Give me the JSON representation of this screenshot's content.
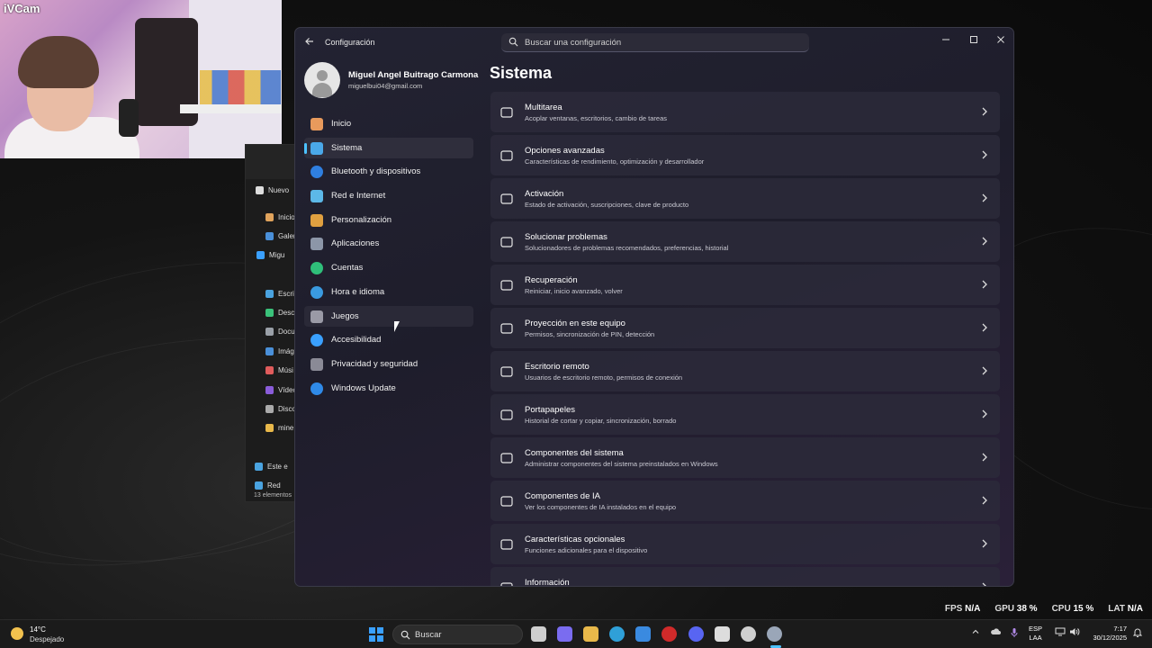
{
  "webcam": {
    "watermark": "iVCam"
  },
  "explorer": {
    "items": [
      {
        "label": "Nuevo",
        "icon": "plus-circle-icon",
        "color": "#dddddd"
      },
      {
        "label": "Inicio",
        "icon": "home-icon",
        "color": "#e0a35c"
      },
      {
        "label": "Galer",
        "icon": "gallery-icon",
        "color": "#4a90d9"
      },
      {
        "label": "Migu",
        "icon": "cloud-icon",
        "color": "#3aa0ff"
      },
      {
        "label": "Escrit",
        "icon": "desktop-icon",
        "color": "#4aa3e0"
      },
      {
        "label": "Desca",
        "icon": "download-icon",
        "color": "#3ac27a"
      },
      {
        "label": "Docu",
        "icon": "document-icon",
        "color": "#9aa0a8"
      },
      {
        "label": "Imág",
        "icon": "image-icon",
        "color": "#4a90d9"
      },
      {
        "label": "Músi",
        "icon": "music-icon",
        "color": "#e05c5c"
      },
      {
        "label": "Vídeo",
        "icon": "video-icon",
        "color": "#8a5cd9"
      },
      {
        "label": "Disco",
        "icon": "disk-icon",
        "color": "#aaaaaa"
      },
      {
        "label": "mine",
        "icon": "folder-icon",
        "color": "#e8b84a"
      },
      {
        "label": "Este e",
        "icon": "pc-icon",
        "color": "#4aa3e0"
      },
      {
        "label": "Red",
        "icon": "network-icon",
        "color": "#4aa3e0"
      }
    ],
    "status": "13 elementos"
  },
  "settings": {
    "app_title": "Configuración",
    "search_placeholder": "Buscar una configuración",
    "profile": {
      "name": "Miguel Angel Buitrago Carmona",
      "email": "miguelbui04@gmail.com"
    },
    "nav": [
      {
        "label": "Inicio",
        "icon": "home-icon",
        "color": "#e89a5c"
      },
      {
        "label": "Sistema",
        "icon": "monitor-icon",
        "color": "#4aa8e8"
      },
      {
        "label": "Bluetooth y dispositivos",
        "icon": "bluetooth-icon",
        "color": "#2f7fe0"
      },
      {
        "label": "Red e Internet",
        "icon": "wifi-icon",
        "color": "#5cb8e8"
      },
      {
        "label": "Personalización",
        "icon": "brush-icon",
        "color": "#e0a040"
      },
      {
        "label": "Aplicaciones",
        "icon": "apps-icon",
        "color": "#8c96a8"
      },
      {
        "label": "Cuentas",
        "icon": "person-icon",
        "color": "#2fbf7a"
      },
      {
        "label": "Hora e idioma",
        "icon": "globe-clock-icon",
        "color": "#3a9ae0"
      },
      {
        "label": "Juegos",
        "icon": "gamepad-icon",
        "color": "#9a9aa6"
      },
      {
        "label": "Accesibilidad",
        "icon": "accessibility-icon",
        "color": "#3aa0ff"
      },
      {
        "label": "Privacidad y seguridad",
        "icon": "shield-icon",
        "color": "#8a8a96"
      },
      {
        "label": "Windows Update",
        "icon": "update-icon",
        "color": "#2f8ae8"
      }
    ],
    "active_nav": "Sistema",
    "page_title": "Sistema",
    "cards": [
      {
        "title": "Multitarea",
        "desc": "Acoplar ventanas, escritorios, cambio de tareas",
        "icon": "multitask-icon"
      },
      {
        "title": "Opciones avanzadas",
        "desc": "Características de rendimiento, optimización y desarrollador",
        "icon": "sliders-icon"
      },
      {
        "title": "Activación",
        "desc": "Estado de activación, suscripciones, clave de producto",
        "icon": "check-circle-icon"
      },
      {
        "title": "Solucionar problemas",
        "desc": "Solucionadores de problemas recomendados, preferencias, historial",
        "icon": "wrench-icon"
      },
      {
        "title": "Recuperación",
        "desc": "Reiniciar, inicio avanzado, volver",
        "icon": "recovery-icon"
      },
      {
        "title": "Proyección en este equipo",
        "desc": "Permisos, sincronización de PIN, detección",
        "icon": "projection-icon"
      },
      {
        "title": "Escritorio remoto",
        "desc": "Usuarios de escritorio remoto, permisos de conexión",
        "icon": "remote-desktop-icon"
      },
      {
        "title": "Portapapeles",
        "desc": "Historial de cortar y copiar, sincronización, borrado",
        "icon": "clipboard-icon"
      },
      {
        "title": "Componentes del sistema",
        "desc": "Administrar componentes del sistema preinstalados en Windows",
        "icon": "components-icon"
      },
      {
        "title": "Componentes de IA",
        "desc": "Ver los componentes de IA instalados en el equipo",
        "icon": "sparkle-icon"
      },
      {
        "title": "Características opcionales",
        "desc": "Funciones adicionales para el dispositivo",
        "icon": "add-features-icon"
      },
      {
        "title": "Información",
        "desc": "",
        "icon": "info-icon"
      }
    ]
  },
  "stats": {
    "fps_label": "FPS",
    "fps_value": "N/A",
    "gpu_label": "GPU",
    "gpu_value": "38 %",
    "cpu_label": "CPU",
    "cpu_value": "15 %",
    "lat_label": "LAT",
    "lat_value": "N/A"
  },
  "taskbar": {
    "weather_temp": "14°C",
    "weather_desc": "Despejado",
    "search_label": "Buscar",
    "apps": [
      {
        "name": "task-view-icon",
        "color": "#cfcfcf"
      },
      {
        "name": "copilot-icon",
        "color": "#7a6cf0"
      },
      {
        "name": "file-explorer-icon",
        "color": "#e8b84a"
      },
      {
        "name": "edge-icon",
        "color": "#2fa0d8"
      },
      {
        "name": "store-icon",
        "color": "#3a8ae0"
      },
      {
        "name": "opera-icon",
        "color": "#d02a2a"
      },
      {
        "name": "discord-icon",
        "color": "#5865f2"
      },
      {
        "name": "epic-games-icon",
        "color": "#dddddd"
      },
      {
        "name": "steam-icon",
        "color": "#cfcfcf"
      },
      {
        "name": "settings-icon",
        "color": "#9aa6b8"
      }
    ],
    "lang_1": "ESP",
    "lang_2": "LAA",
    "time": "7:17",
    "date": "30/12/2025"
  }
}
